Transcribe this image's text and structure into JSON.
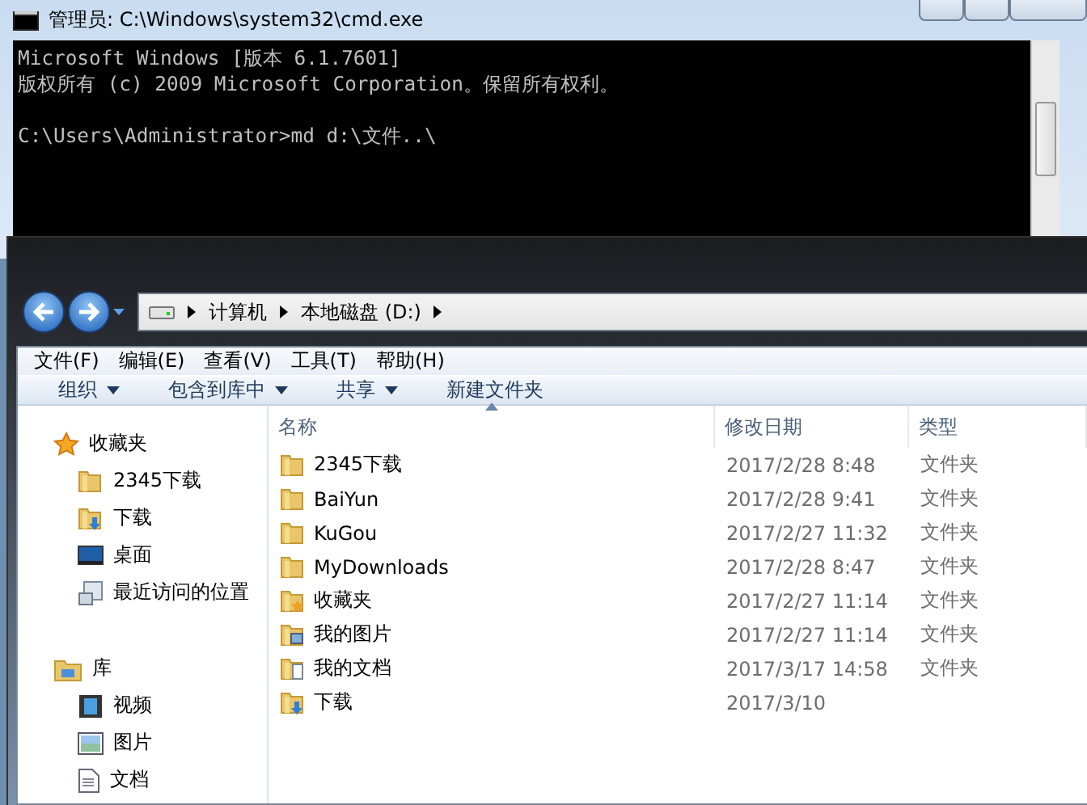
{
  "cmd_window": {
    "title": "管理员: C:\\Windows\\system32\\cmd.exe",
    "banner": [
      "Microsoft Windows [版本 6.1.7601]",
      "版权所有 (c) 2009 Microsoft Corporation。保留所有权利。"
    ],
    "prompt": "C:\\Users\\Administrator>md d:\\文件..\\"
  },
  "explorer": {
    "address": [
      "计算机",
      "本地磁盘 (D:)"
    ],
    "menu": [
      "文件(F)",
      "编辑(E)",
      "查看(V)",
      "工具(T)",
      "帮助(H)"
    ],
    "toolbar": [
      {
        "label": "组织",
        "dropdown": true
      },
      {
        "label": "包含到库中",
        "dropdown": true
      },
      {
        "label": "共享",
        "dropdown": true
      },
      {
        "label": "新建文件夹",
        "dropdown": false
      }
    ],
    "nav_pane": [
      {
        "label": "收藏夹",
        "kind": "star",
        "children": [
          {
            "label": "2345下载",
            "kind": "folder"
          },
          {
            "label": "下载",
            "kind": "download"
          },
          {
            "label": "桌面",
            "kind": "desktop"
          },
          {
            "label": "最近访问的位置",
            "kind": "recent"
          }
        ]
      },
      {
        "label": "库",
        "kind": "library",
        "children": [
          {
            "label": "视频",
            "kind": "video"
          },
          {
            "label": "图片",
            "kind": "picture"
          },
          {
            "label": "文档",
            "kind": "document"
          }
        ]
      }
    ],
    "columns": [
      "名称",
      "修改日期",
      "类型"
    ],
    "rows": [
      {
        "name": "2345下载",
        "date": "2017/2/28 8:48",
        "type": "文件夹",
        "kind": "folder"
      },
      {
        "name": "BaiYun",
        "date": "2017/2/28 9:41",
        "type": "文件夹",
        "kind": "folder"
      },
      {
        "name": "KuGou",
        "date": "2017/2/27 11:32",
        "type": "文件夹",
        "kind": "folder"
      },
      {
        "name": "MyDownloads",
        "date": "2017/2/28 8:47",
        "type": "文件夹",
        "kind": "folder"
      },
      {
        "name": "收藏夹",
        "date": "2017/2/27 11:14",
        "type": "文件夹",
        "kind": "favorites"
      },
      {
        "name": "我的图片",
        "date": "2017/2/27 11:14",
        "type": "文件夹",
        "kind": "picture"
      },
      {
        "name": "我的文档",
        "date": "2017/3/17 14:58",
        "type": "文件夹",
        "kind": "document"
      },
      {
        "name": "下载",
        "date": "2017/3/10",
        "kind": "download"
      }
    ]
  }
}
